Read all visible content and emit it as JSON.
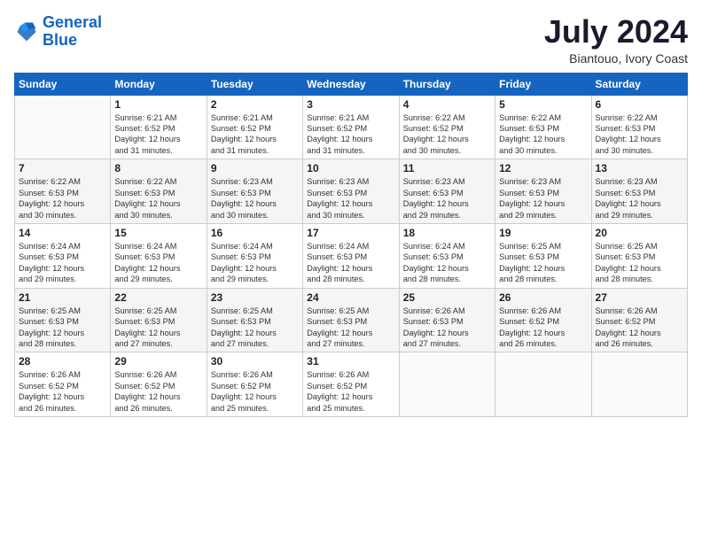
{
  "header": {
    "logo_line1": "General",
    "logo_line2": "Blue",
    "month_year": "July 2024",
    "location": "Biantouo, Ivory Coast"
  },
  "days_of_week": [
    "Sunday",
    "Monday",
    "Tuesday",
    "Wednesday",
    "Thursday",
    "Friday",
    "Saturday"
  ],
  "weeks": [
    [
      {
        "num": "",
        "info": ""
      },
      {
        "num": "1",
        "info": "Sunrise: 6:21 AM\nSunset: 6:52 PM\nDaylight: 12 hours\nand 31 minutes."
      },
      {
        "num": "2",
        "info": "Sunrise: 6:21 AM\nSunset: 6:52 PM\nDaylight: 12 hours\nand 31 minutes."
      },
      {
        "num": "3",
        "info": "Sunrise: 6:21 AM\nSunset: 6:52 PM\nDaylight: 12 hours\nand 31 minutes."
      },
      {
        "num": "4",
        "info": "Sunrise: 6:22 AM\nSunset: 6:52 PM\nDaylight: 12 hours\nand 30 minutes."
      },
      {
        "num": "5",
        "info": "Sunrise: 6:22 AM\nSunset: 6:53 PM\nDaylight: 12 hours\nand 30 minutes."
      },
      {
        "num": "6",
        "info": "Sunrise: 6:22 AM\nSunset: 6:53 PM\nDaylight: 12 hours\nand 30 minutes."
      }
    ],
    [
      {
        "num": "7",
        "info": "Sunrise: 6:22 AM\nSunset: 6:53 PM\nDaylight: 12 hours\nand 30 minutes."
      },
      {
        "num": "8",
        "info": "Sunrise: 6:22 AM\nSunset: 6:53 PM\nDaylight: 12 hours\nand 30 minutes."
      },
      {
        "num": "9",
        "info": "Sunrise: 6:23 AM\nSunset: 6:53 PM\nDaylight: 12 hours\nand 30 minutes."
      },
      {
        "num": "10",
        "info": "Sunrise: 6:23 AM\nSunset: 6:53 PM\nDaylight: 12 hours\nand 30 minutes."
      },
      {
        "num": "11",
        "info": "Sunrise: 6:23 AM\nSunset: 6:53 PM\nDaylight: 12 hours\nand 29 minutes."
      },
      {
        "num": "12",
        "info": "Sunrise: 6:23 AM\nSunset: 6:53 PM\nDaylight: 12 hours\nand 29 minutes."
      },
      {
        "num": "13",
        "info": "Sunrise: 6:23 AM\nSunset: 6:53 PM\nDaylight: 12 hours\nand 29 minutes."
      }
    ],
    [
      {
        "num": "14",
        "info": "Sunrise: 6:24 AM\nSunset: 6:53 PM\nDaylight: 12 hours\nand 29 minutes."
      },
      {
        "num": "15",
        "info": "Sunrise: 6:24 AM\nSunset: 6:53 PM\nDaylight: 12 hours\nand 29 minutes."
      },
      {
        "num": "16",
        "info": "Sunrise: 6:24 AM\nSunset: 6:53 PM\nDaylight: 12 hours\nand 29 minutes."
      },
      {
        "num": "17",
        "info": "Sunrise: 6:24 AM\nSunset: 6:53 PM\nDaylight: 12 hours\nand 28 minutes."
      },
      {
        "num": "18",
        "info": "Sunrise: 6:24 AM\nSunset: 6:53 PM\nDaylight: 12 hours\nand 28 minutes."
      },
      {
        "num": "19",
        "info": "Sunrise: 6:25 AM\nSunset: 6:53 PM\nDaylight: 12 hours\nand 28 minutes."
      },
      {
        "num": "20",
        "info": "Sunrise: 6:25 AM\nSunset: 6:53 PM\nDaylight: 12 hours\nand 28 minutes."
      }
    ],
    [
      {
        "num": "21",
        "info": "Sunrise: 6:25 AM\nSunset: 6:53 PM\nDaylight: 12 hours\nand 28 minutes."
      },
      {
        "num": "22",
        "info": "Sunrise: 6:25 AM\nSunset: 6:53 PM\nDaylight: 12 hours\nand 27 minutes."
      },
      {
        "num": "23",
        "info": "Sunrise: 6:25 AM\nSunset: 6:53 PM\nDaylight: 12 hours\nand 27 minutes."
      },
      {
        "num": "24",
        "info": "Sunrise: 6:25 AM\nSunset: 6:53 PM\nDaylight: 12 hours\nand 27 minutes."
      },
      {
        "num": "25",
        "info": "Sunrise: 6:26 AM\nSunset: 6:53 PM\nDaylight: 12 hours\nand 27 minutes."
      },
      {
        "num": "26",
        "info": "Sunrise: 6:26 AM\nSunset: 6:52 PM\nDaylight: 12 hours\nand 26 minutes."
      },
      {
        "num": "27",
        "info": "Sunrise: 6:26 AM\nSunset: 6:52 PM\nDaylight: 12 hours\nand 26 minutes."
      }
    ],
    [
      {
        "num": "28",
        "info": "Sunrise: 6:26 AM\nSunset: 6:52 PM\nDaylight: 12 hours\nand 26 minutes."
      },
      {
        "num": "29",
        "info": "Sunrise: 6:26 AM\nSunset: 6:52 PM\nDaylight: 12 hours\nand 26 minutes."
      },
      {
        "num": "30",
        "info": "Sunrise: 6:26 AM\nSunset: 6:52 PM\nDaylight: 12 hours\nand 25 minutes."
      },
      {
        "num": "31",
        "info": "Sunrise: 6:26 AM\nSunset: 6:52 PM\nDaylight: 12 hours\nand 25 minutes."
      },
      {
        "num": "",
        "info": ""
      },
      {
        "num": "",
        "info": ""
      },
      {
        "num": "",
        "info": ""
      }
    ]
  ]
}
